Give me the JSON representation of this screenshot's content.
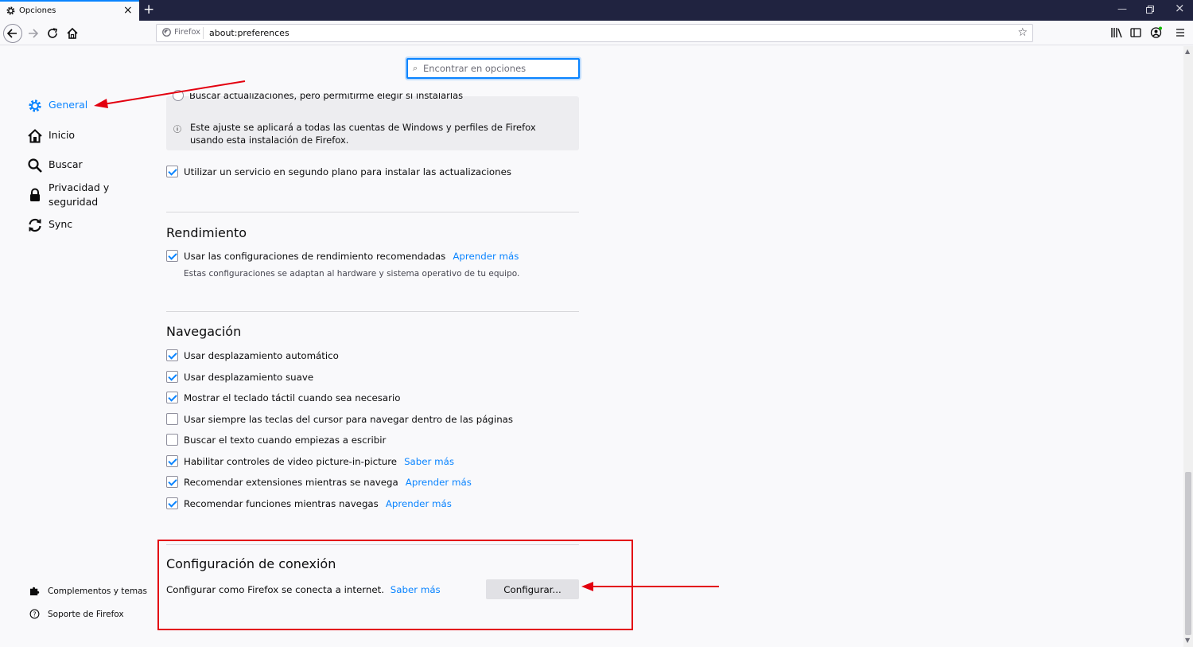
{
  "window": {
    "tab_title": "Opciones",
    "tab_icon": "gear-icon",
    "new_tab_symbol": "+",
    "controls": [
      "minimize-icon",
      "restore-icon",
      "close-icon"
    ]
  },
  "toolbar": {
    "identity_label": "Firefox",
    "url": "about:preferences",
    "right_icons": [
      "library-icon",
      "sidebar-icon",
      "account-icon",
      "menu-icon"
    ]
  },
  "search": {
    "placeholder": "Encontrar en opciones"
  },
  "sidebar": {
    "categories": [
      {
        "label": "General",
        "icon": "gear-icon",
        "selected": true
      },
      {
        "label": "Inicio",
        "icon": "home-icon"
      },
      {
        "label": "Buscar",
        "icon": "search-icon"
      },
      {
        "label": "Privacidad y seguridad",
        "line1": "Privacidad y",
        "line2": "seguridad",
        "icon": "lock-icon"
      },
      {
        "label": "Sync",
        "icon": "sync-icon"
      }
    ],
    "footer": [
      {
        "label": "Complementos y temas",
        "icon": "puzzle-icon"
      },
      {
        "label": "Soporte de Firefox",
        "icon": "help-icon"
      }
    ]
  },
  "updates": {
    "partial_option": "Buscar actualizaciones, pero permitirme elegir si instalarlas",
    "info": "Este ajuste se aplicará a todas las cuentas de Windows y perfiles de Firefox usando esta instalación de Firefox.",
    "background_service": {
      "label": "Utilizar un servicio en segundo plano para instalar las actualizaciones",
      "checked": true
    }
  },
  "performance": {
    "title": "Rendimiento",
    "recommended": {
      "label": "Usar las configuraciones de rendimiento recomendadas",
      "checked": true,
      "link": "Aprender más"
    },
    "description": "Estas configuraciones se adaptan al hardware y sistema operativo de tu equipo."
  },
  "navigation": {
    "title": "Navegación",
    "items": [
      {
        "label": "Usar desplazamiento automático",
        "checked": true
      },
      {
        "label": "Usar desplazamiento suave",
        "checked": true
      },
      {
        "label": "Mostrar el teclado táctil cuando sea necesario",
        "checked": true
      },
      {
        "label": "Usar siempre las teclas del cursor para navegar dentro de las páginas",
        "checked": false
      },
      {
        "label": "Buscar el texto cuando empiezas a escribir",
        "checked": false
      },
      {
        "label": "Habilitar controles de video picture-in-picture",
        "checked": true,
        "link": "Saber más"
      },
      {
        "label": "Recomendar extensiones mientras se navega",
        "checked": true,
        "link": "Aprender más"
      },
      {
        "label": "Recomendar funciones mientras navegas",
        "checked": true,
        "link": "Aprender más"
      }
    ]
  },
  "connection": {
    "title": "Configuración de conexión",
    "description": "Configurar como Firefox se conecta a internet.",
    "link": "Saber más",
    "button": "Configurar..."
  },
  "colors": {
    "accent": "#0a84ff",
    "annotation": "#e3000f",
    "tabbar": "#202340"
  }
}
